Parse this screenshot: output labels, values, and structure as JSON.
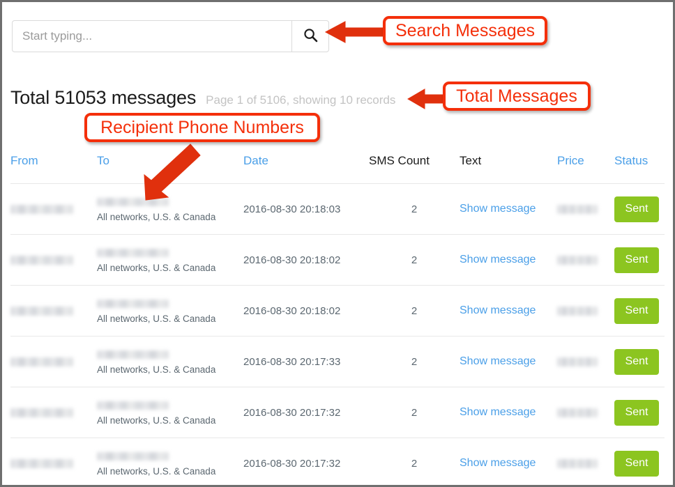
{
  "search": {
    "placeholder": "Start typing...",
    "value": "",
    "icon": "search-icon",
    "button_label": ""
  },
  "summary": {
    "total_text": "Total 51053 messages",
    "total_count": 51053,
    "paging_text": "Page 1 of 5106, showing 10 records",
    "page": 1,
    "pages": 5106,
    "records_shown": 10
  },
  "table": {
    "columns": [
      {
        "label": "From",
        "sortable": true,
        "color": "#4a9fe8"
      },
      {
        "label": "To",
        "sortable": true,
        "color": "#4a9fe8"
      },
      {
        "label": "Date",
        "sortable": true,
        "color": "#4a9fe8"
      },
      {
        "label": "SMS Count",
        "sortable": false,
        "color": "#1b1b1b"
      },
      {
        "label": "Text",
        "sortable": false,
        "color": "#1b1b1b"
      },
      {
        "label": "Price",
        "sortable": true,
        "color": "#4a9fe8"
      },
      {
        "label": "Status",
        "sortable": true,
        "color": "#4a9fe8"
      }
    ],
    "network_note": "All networks, U.S. & Canada",
    "show_message_label": "Show message",
    "rows": [
      {
        "from": "",
        "to": "",
        "network": "All networks, U.S. & Canada",
        "date": "2016-08-30 20:18:03",
        "sms_count": "2",
        "text_link": "Show message",
        "price": "",
        "status": "Sent"
      },
      {
        "from": "",
        "to": "",
        "network": "All networks, U.S. & Canada",
        "date": "2016-08-30 20:18:02",
        "sms_count": "2",
        "text_link": "Show message",
        "price": "",
        "status": "Sent"
      },
      {
        "from": "",
        "to": "",
        "network": "All networks, U.S. & Canada",
        "date": "2016-08-30 20:18:02",
        "sms_count": "2",
        "text_link": "Show message",
        "price": "",
        "status": "Sent"
      },
      {
        "from": "",
        "to": "",
        "network": "All networks, U.S. & Canada",
        "date": "2016-08-30 20:17:33",
        "sms_count": "2",
        "text_link": "Show message",
        "price": "",
        "status": "Sent"
      },
      {
        "from": "",
        "to": "",
        "network": "All networks, U.S. & Canada",
        "date": "2016-08-30 20:17:32",
        "sms_count": "2",
        "text_link": "Show message",
        "price": "",
        "status": "Sent"
      },
      {
        "from": "",
        "to": "",
        "network": "All networks, U.S. & Canada",
        "date": "2016-08-30 20:17:32",
        "sms_count": "2",
        "text_link": "Show message",
        "price": "",
        "status": "Sent"
      }
    ]
  },
  "annotations": [
    {
      "label": "Search Messages",
      "color": "#f42f0a"
    },
    {
      "label": "Total Messages",
      "color": "#f42f0a"
    },
    {
      "label": "Recipient Phone Numbers",
      "color": "#f42f0a"
    }
  ],
  "colors": {
    "link_blue": "#4a9fe8",
    "badge_green": "#8cc520",
    "annotation_red": "#f42f0a",
    "muted_gray": "#c3c3c3",
    "body_text": "#5b6770"
  }
}
